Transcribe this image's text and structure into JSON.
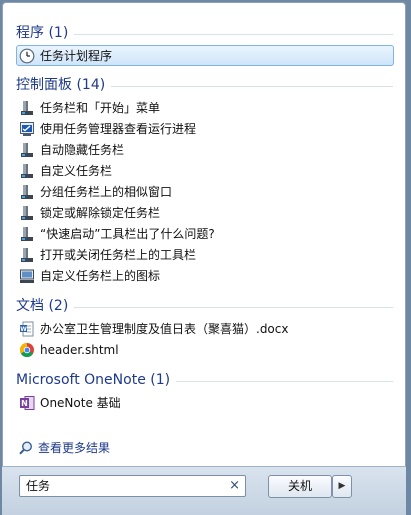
{
  "sections": {
    "programs": {
      "title": "程序 (1)",
      "items": [
        {
          "label": "任务计划程序",
          "icon": "clock-icon"
        }
      ]
    },
    "control_panel": {
      "title": "控制面板 (14)",
      "items": [
        {
          "label": "任务栏和「开始」菜单",
          "icon": "taskbar-icon"
        },
        {
          "label": "使用任务管理器查看运行进程",
          "icon": "task-manager-icon"
        },
        {
          "label": "自动隐藏任务栏",
          "icon": "taskbar-icon"
        },
        {
          "label": "自定义任务栏",
          "icon": "taskbar-icon"
        },
        {
          "label": "分组任务栏上的相似窗口",
          "icon": "taskbar-icon"
        },
        {
          "label": "锁定或解除锁定任务栏",
          "icon": "taskbar-icon"
        },
        {
          "label": "“快速启动”工具栏出了什么问题?",
          "icon": "taskbar-icon"
        },
        {
          "label": "打开或关闭任务栏上的工具栏",
          "icon": "taskbar-icon"
        },
        {
          "label": "自定义任务栏上的图标",
          "icon": "monitor-icon"
        }
      ]
    },
    "documents": {
      "title": "文档 (2)",
      "items": [
        {
          "label": "办公室卫生管理制度及值日表（聚喜猫）.docx",
          "icon": "word-doc-icon"
        },
        {
          "label": "header.shtml",
          "icon": "chrome-icon"
        }
      ]
    },
    "onenote": {
      "title": "Microsoft OneNote (1)",
      "items": [
        {
          "label": "OneNote 基础",
          "icon": "onenote-icon"
        }
      ]
    }
  },
  "more_results": "查看更多结果",
  "search": {
    "value": "任务",
    "clear": "×"
  },
  "shutdown": {
    "label": "关机",
    "arrow": "▶"
  },
  "colors": {
    "accent": "#1e3a8a",
    "selection_border": "#7eb4ea"
  }
}
